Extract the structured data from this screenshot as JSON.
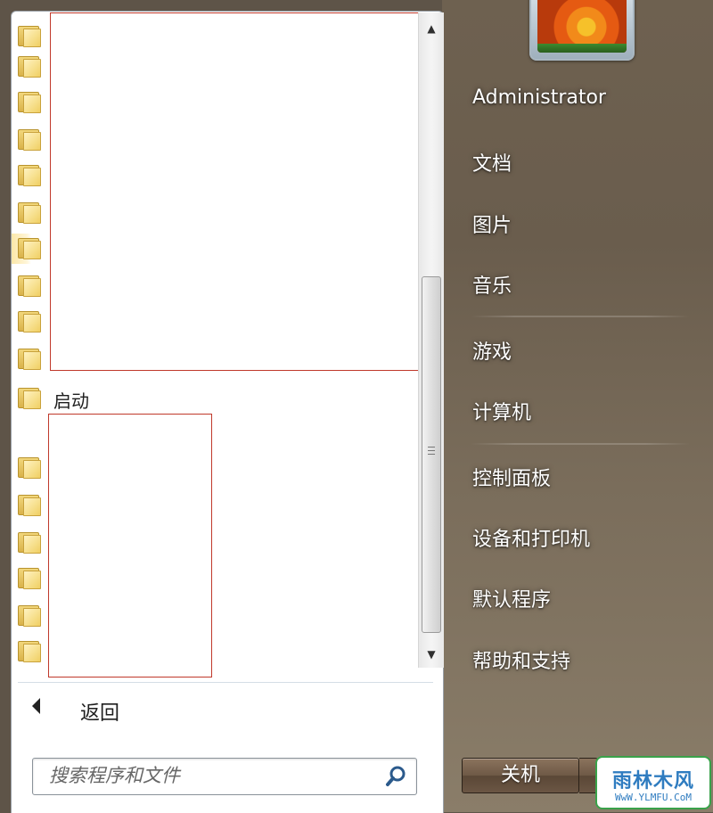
{
  "user": {
    "name": "Administrator"
  },
  "right_menu": {
    "documents": "文档",
    "pictures": "图片",
    "music": "音乐",
    "games": "游戏",
    "computer": "计算机",
    "control_panel": "控制面板",
    "devices_printers": "设备和打印机",
    "default_programs": "默认程序",
    "help_support": "帮助和支持"
  },
  "programs": {
    "startup_folder": "启动"
  },
  "footer": {
    "back_label": "返回",
    "search_placeholder": "搜索程序和文件",
    "shutdown_label": "关机"
  },
  "watermark": {
    "title": "雨林木风",
    "url": "WwW.YLMFU.CoM"
  },
  "icons": {
    "folder": "folder-icon",
    "search": "magnifier-icon",
    "back": "triangle-left-icon",
    "scroll_up": "arrow-up-icon",
    "scroll_down": "arrow-down-icon"
  },
  "colors": {
    "right_pane": "#6e6150",
    "left_pane": "#ffffff",
    "redaction_border": "#c0392b",
    "watermark_border": "#3aa24a",
    "watermark_text": "#2f7cc0"
  }
}
